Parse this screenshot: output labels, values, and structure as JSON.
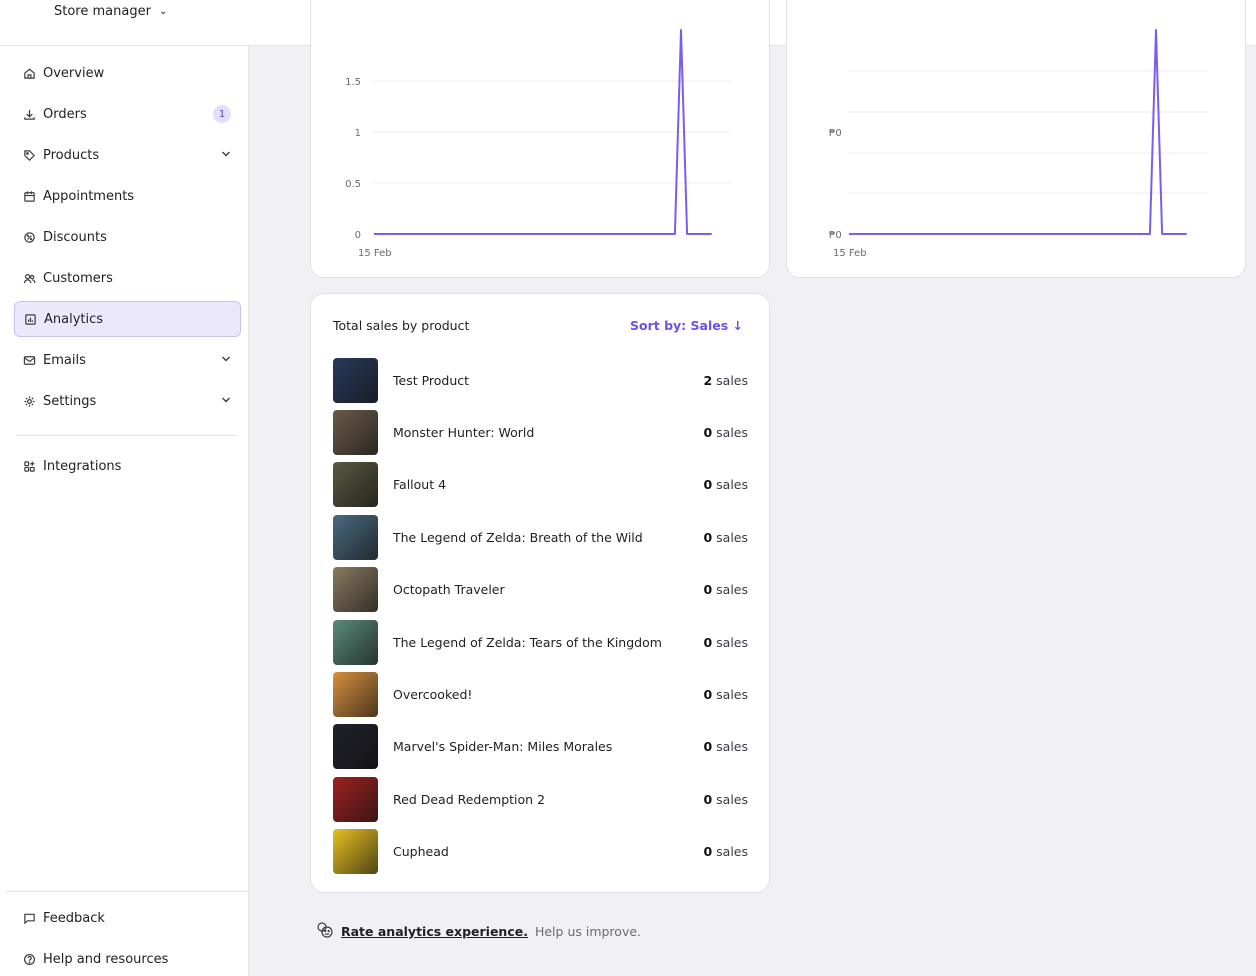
{
  "header": {
    "store_name": "Store manager"
  },
  "sidebar": {
    "items": [
      {
        "label": "Overview"
      },
      {
        "label": "Orders",
        "badge": "1"
      },
      {
        "label": "Products"
      },
      {
        "label": "Appointments"
      },
      {
        "label": "Discounts"
      },
      {
        "label": "Customers"
      },
      {
        "label": "Analytics",
        "active": true
      },
      {
        "label": "Emails"
      },
      {
        "label": "Settings"
      },
      {
        "label": "Integrations"
      }
    ],
    "footer": [
      {
        "label": "Feedback"
      },
      {
        "label": "Help and resources"
      }
    ]
  },
  "chart_data": [
    {
      "type": "line",
      "x_ticks": [
        "15 Feb"
      ],
      "y_ticks": [
        "0",
        "0.5",
        "1",
        "1.5"
      ],
      "series": [
        {
          "values": [
            0,
            0,
            0,
            0,
            0,
            0,
            0,
            0,
            0,
            0,
            0,
            0,
            0,
            0,
            0,
            0,
            0,
            0,
            0,
            0,
            0,
            0,
            0,
            0,
            0,
            0,
            0,
            0,
            0,
            0,
            0,
            0,
            0,
            0,
            0,
            0,
            0,
            0,
            0,
            0,
            0,
            0,
            0,
            0,
            0,
            0,
            0,
            0,
            0,
            0,
            2,
            0,
            0,
            0,
            0,
            0
          ]
        }
      ],
      "color": "#7b5cf0"
    },
    {
      "type": "line",
      "x_ticks": [
        "15 Feb"
      ],
      "y_ticks": [
        "₱0",
        "₱0"
      ],
      "series": [
        {
          "values": [
            0,
            0,
            0,
            0,
            0,
            0,
            0,
            0,
            0,
            0,
            0,
            0,
            0,
            0,
            0,
            0,
            0,
            0,
            0,
            0,
            0,
            0,
            0,
            0,
            0,
            0,
            0,
            0,
            0,
            0,
            0,
            0,
            0,
            0,
            0,
            0,
            0,
            0,
            0,
            0,
            0,
            0,
            0,
            0,
            0,
            0,
            0,
            0,
            0,
            0,
            2,
            0,
            0,
            0,
            0,
            0
          ]
        }
      ],
      "color": "#7b5cf0"
    }
  ],
  "products_card": {
    "title": "Total sales by product",
    "sort_label": "Sort by: Sales ↓",
    "sales_suffix": "sales",
    "products": [
      {
        "name": "Test Product",
        "sales": "2",
        "thumb_color": "#2a3a5c"
      },
      {
        "name": "Monster Hunter: World",
        "sales": "0",
        "thumb_color": "#6b5a4a"
      },
      {
        "name": "Fallout 4",
        "sales": "0",
        "thumb_color": "#5a5a40"
      },
      {
        "name": "The Legend of Zelda: Breath of the Wild",
        "sales": "0",
        "thumb_color": "#4a6a80"
      },
      {
        "name": "Octopath Traveler",
        "sales": "0",
        "thumb_color": "#8a7a60"
      },
      {
        "name": "The Legend of Zelda: Tears of the Kingdom",
        "sales": "0",
        "thumb_color": "#5a8a7a"
      },
      {
        "name": "Overcooked!",
        "sales": "0",
        "thumb_color": "#d89040"
      },
      {
        "name": "Marvel's Spider-Man: Miles Morales",
        "sales": "0",
        "thumb_color": "#20202a"
      },
      {
        "name": "Red Dead Redemption 2",
        "sales": "0",
        "thumb_color": "#a02020"
      },
      {
        "name": "Cuphead",
        "sales": "0",
        "thumb_color": "#e8c020"
      }
    ]
  },
  "footer_note": {
    "link_text": "Rate analytics experience.",
    "text": "Help us improve."
  }
}
